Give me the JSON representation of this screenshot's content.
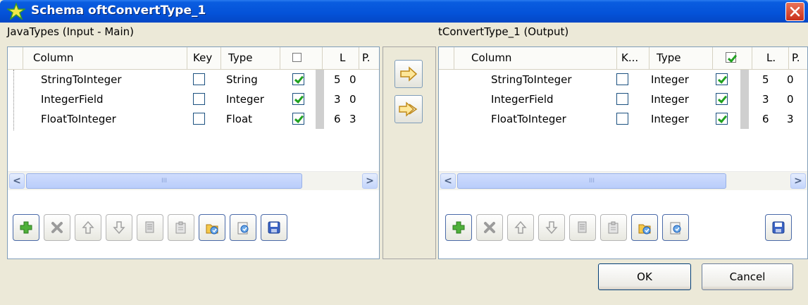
{
  "window": {
    "title": "Schema oftConvertType_1"
  },
  "left": {
    "label": "JavaTypes (Input - Main)",
    "headers": [
      "Column",
      "Key",
      "Type",
      "",
      "L",
      "P."
    ],
    "rows": [
      {
        "column": "StringToInteger",
        "key": false,
        "type": "String",
        "nullable": true,
        "length": "5",
        "precision": "0"
      },
      {
        "column": "IntegerField",
        "key": false,
        "type": "Integer",
        "nullable": true,
        "length": "3",
        "precision": "0"
      },
      {
        "column": "FloatToInteger",
        "key": false,
        "type": "Float",
        "nullable": true,
        "length": "6",
        "precision": "3"
      }
    ]
  },
  "right": {
    "label": "tConvertType_1 (Output)",
    "headers": [
      "Column",
      "K...",
      "Type",
      "",
      "L.",
      "P."
    ],
    "rows": [
      {
        "column": "StringToInteger",
        "key": false,
        "type": "Integer",
        "nullable": true,
        "length": "5",
        "precision": "0"
      },
      {
        "column": "IntegerField",
        "key": false,
        "type": "Integer",
        "nullable": true,
        "length": "3",
        "precision": "0"
      },
      {
        "column": "FloatToInteger",
        "key": false,
        "type": "Integer",
        "nullable": true,
        "length": "6",
        "precision": "3"
      }
    ]
  },
  "scrollbar": {
    "grip": "III"
  },
  "buttons": {
    "ok": "OK",
    "cancel": "Cancel"
  },
  "icons": {
    "add": "plus-icon",
    "delete": "x-icon",
    "up": "arrow-up-icon",
    "down": "arrow-down-icon",
    "copy": "copy-icon",
    "paste": "paste-icon",
    "import": "import-icon",
    "export": "export-icon",
    "save": "save-icon"
  }
}
